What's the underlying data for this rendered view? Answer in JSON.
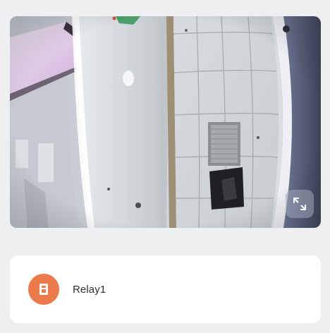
{
  "camera": {
    "feed_description": "live-camera-view",
    "fullscreen_icon": "expand-icon"
  },
  "relays": [
    {
      "label": "Relay1",
      "icon": "relay-switch-icon",
      "icon_color": "#ec7a4c"
    }
  ],
  "colors": {
    "background": "#eeeff1",
    "card": "#ffffff",
    "accent": "#ec7a4c",
    "text": "#2d2f33"
  }
}
